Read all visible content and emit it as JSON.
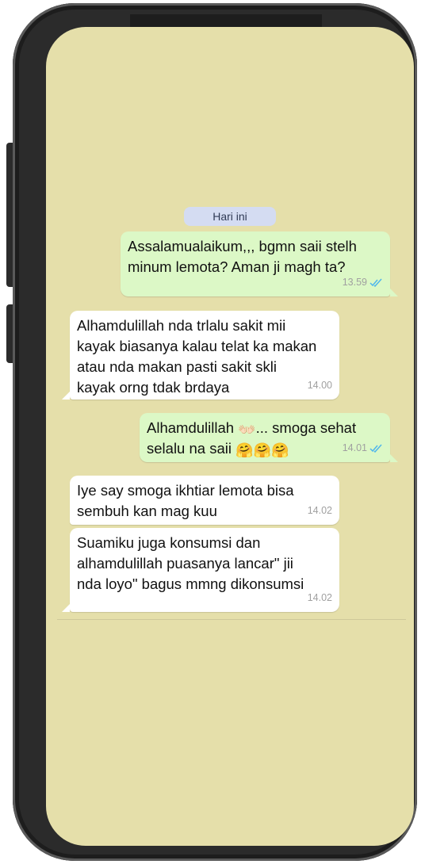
{
  "chat": {
    "date_label": "Hari ini",
    "messages": [
      {
        "direction": "out",
        "text": "Assalamualaikum,,, bgmn saii stelh\nminum lemota? Aman ji magh ta?",
        "time": "13.59",
        "status": "read"
      },
      {
        "direction": "in",
        "text": "Alhamdulillah nda trlalu sakit mii\nkayak biasanya kalau telat ka makan\natau nda makan pasti sakit skli\nkayak orng tdak brdaya",
        "time": "14.00"
      },
      {
        "direction": "out",
        "text_line1_prefix": "Alhamdulillah",
        "emoji_hands": "👐🏻",
        "text_line1_suffix": "... smoga sehat",
        "text_line2": "selalu na saii",
        "emoji_hug": "🤗",
        "time": "14.01",
        "status": "read"
      },
      {
        "direction": "in",
        "text": "Iye say smoga ikhtiar lemota bisa\nsembuh kan mag kuu",
        "time": "14.02"
      },
      {
        "direction": "in",
        "text": "Suamiku juga konsumsi dan\nalhamdulillah puasanya lancar\" jii\nnda loyo\" bagus mmng dikonsumsi",
        "time": "14.02"
      }
    ]
  },
  "colors": {
    "wallpaper": "#e5dfaa",
    "outgoing_bubble": "#dcf8c6",
    "incoming_bubble": "#ffffff",
    "date_chip": "#d4dcf2",
    "read_ticks": "#4fb6ec"
  },
  "icons": {
    "read_receipt": "double-check-icon"
  }
}
